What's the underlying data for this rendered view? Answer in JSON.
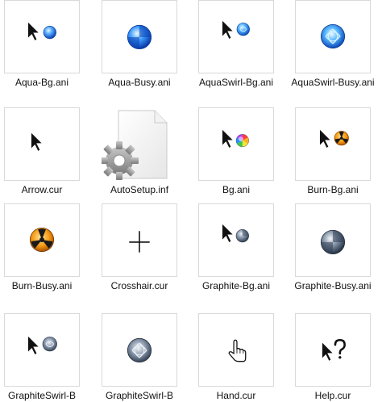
{
  "files": [
    {
      "name": "Aqua-Bg.ani",
      "icon": "arrow-with-blue-orb-icon"
    },
    {
      "name": "Aqua-Busy.ani",
      "icon": "blue-orb-icon"
    },
    {
      "name": "AquaSwirl-Bg.ani",
      "icon": "arrow-with-blue-swirl-icon"
    },
    {
      "name": "AquaSwirl-Busy.ani",
      "icon": "blue-swirl-orb-icon"
    },
    {
      "name": "Arrow.cur",
      "icon": "arrow-cursor-icon"
    },
    {
      "name": "AutoSetup.inf",
      "icon": "settings-file-icon"
    },
    {
      "name": "Bg.ani",
      "icon": "arrow-with-rainbow-orb-icon"
    },
    {
      "name": "Burn-Bg.ani",
      "icon": "arrow-with-radiation-orb-icon"
    },
    {
      "name": "Burn-Busy.ani",
      "icon": "radiation-orb-icon"
    },
    {
      "name": "Crosshair.cur",
      "icon": "crosshair-icon"
    },
    {
      "name": "Graphite-Bg.ani",
      "icon": "arrow-with-graphite-orb-icon"
    },
    {
      "name": "Graphite-Busy.ani",
      "icon": "graphite-orb-icon"
    },
    {
      "name": "GraphiteSwirl-B",
      "icon": "arrow-with-graphite-swirl-icon"
    },
    {
      "name": "GraphiteSwirl-B",
      "icon": "graphite-swirl-orb-icon"
    },
    {
      "name": "Hand.cur",
      "icon": "hand-cursor-icon"
    },
    {
      "name": "Help.cur",
      "icon": "help-cursor-icon"
    }
  ],
  "colors": {
    "aqua": "#1f6fe0",
    "aqua_light": "#8fd0ff",
    "graphite": "#5c6c80",
    "graphite_light": "#c9d3df",
    "burn": "#f08a10"
  }
}
